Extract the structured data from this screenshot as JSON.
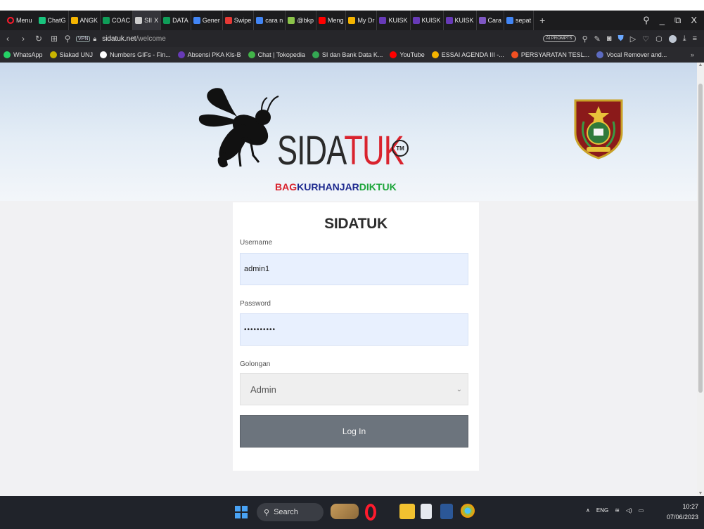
{
  "browser": {
    "menu_label": "Menu",
    "tabs": [
      {
        "label": "ChatG",
        "color": "#19c37d"
      },
      {
        "label": "ANGK",
        "color": "#f4b400"
      },
      {
        "label": "COAC",
        "color": "#0f9d58"
      },
      {
        "label": "SII",
        "color": "#cccccc",
        "active": true
      },
      {
        "label": "DATA",
        "color": "#0f9d58"
      },
      {
        "label": "Gener",
        "color": "#4285f4"
      },
      {
        "label": "Swipe",
        "color": "#e53935"
      },
      {
        "label": "cara n",
        "color": "#4285f4"
      },
      {
        "label": "@bkp",
        "color": "#8bc34a"
      },
      {
        "label": "Meng",
        "color": "#ff0000"
      },
      {
        "label": "My Dr",
        "color": "#f4b400"
      },
      {
        "label": "KUISK",
        "color": "#673ab7"
      },
      {
        "label": "KUISK",
        "color": "#673ab7"
      },
      {
        "label": "KUISK",
        "color": "#673ab7"
      },
      {
        "label": "Cara",
        "color": "#7e57c2"
      },
      {
        "label": "sepat",
        "color": "#4285f4"
      }
    ],
    "tab_close": "X",
    "new_tab": "+",
    "controls": {
      "search": "⚲",
      "minimize": "_",
      "restore": "⧉",
      "close": "X"
    },
    "address": {
      "vpn": "VPN",
      "host": "sidatuk.net",
      "path": "/welcome",
      "ai_prompts": "AI PROMPTS"
    },
    "bookmarks": [
      {
        "label": "WhatsApp",
        "color": "#25d366"
      },
      {
        "label": "Siakad UNJ",
        "color": "#c8b400"
      },
      {
        "label": "Numbers GIFs - Fin...",
        "color": "#ffffff"
      },
      {
        "label": "Absensi PKA Kls-B",
        "color": "#673ab7"
      },
      {
        "label": "Chat | Tokopedia",
        "color": "#42b549"
      },
      {
        "label": "SI dan Bank Data K...",
        "color": "#34a853"
      },
      {
        "label": "YouTube",
        "color": "#ff0000"
      },
      {
        "label": "ESSAI AGENDA III -...",
        "color": "#f4b400"
      },
      {
        "label": "PERSYARATAN TESL...",
        "color": "#f25022"
      },
      {
        "label": "Vocal Remover and...",
        "color": "#5c6bc0"
      }
    ],
    "bookmarks_more": "»"
  },
  "site": {
    "brand_prefix": "SIDA",
    "brand_suffix": "TUK",
    "trademark": "TM",
    "subbrand": {
      "part1": "BAG",
      "part2": "KURHANJAR",
      "part3": "DIKTUK"
    },
    "colors": {
      "red": "#d9232e",
      "blue": "#1d2a8f",
      "green": "#1ca53a"
    }
  },
  "login": {
    "title": "SIDATUK",
    "username_label": "Username",
    "username_value": "admin1",
    "password_label": "Password",
    "password_value": "••••••••••",
    "golongan_label": "Golongan",
    "golongan_value": "Admin",
    "submit_label": "Log In"
  },
  "taskbar": {
    "search_label": "Search",
    "tray_lang": "ENG",
    "time": "10:27",
    "date": "07/06/2023"
  }
}
